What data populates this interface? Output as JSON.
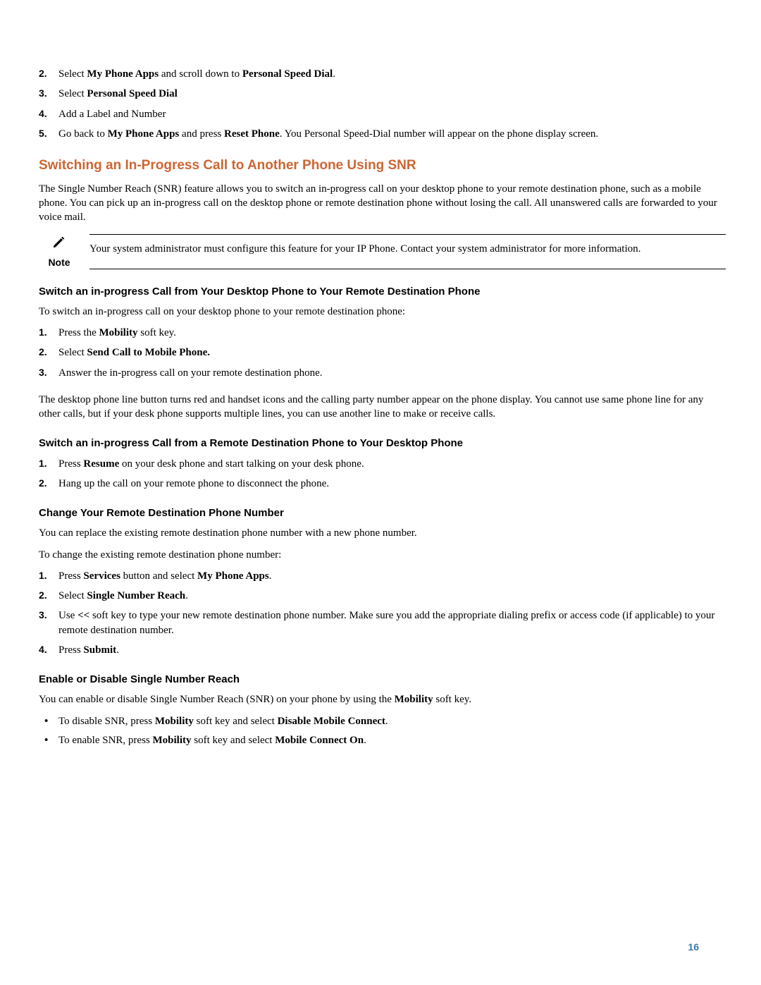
{
  "topList": [
    {
      "num": "2.",
      "html": "Select <b>My Phone Apps</b> and scroll down to <b>Personal Speed Dial</b>."
    },
    {
      "num": "3.",
      "html": "Select <b>Personal Speed Dial</b>"
    },
    {
      "num": "4.",
      "html": "Add a Label and Number"
    },
    {
      "num": "5.",
      "html": "Go back to <b>My Phone Apps</b> and press <b>Reset Phone</b>. You Personal Speed-Dial number will appear on the phone display screen."
    }
  ],
  "snr": {
    "heading": "Switching an In-Progress Call to Another Phone Using SNR",
    "intro": "The Single Number Reach (SNR) feature allows you to switch an in-progress call on your desktop phone to your remote destination phone, such as a mobile phone. You can pick up an in-progress call on the desktop phone or remote destination phone without losing the call. All unanswered calls are forwarded to your voice mail.",
    "noteLabel": "Note",
    "noteText": "Your system administrator must configure this feature for your IP Phone. Contact your system administrator for more information."
  },
  "switchToRemote": {
    "heading": "Switch an in-progress Call from Your Desktop Phone to Your Remote Destination Phone",
    "intro": "To switch an in-progress call on your desktop phone to your remote destination phone:",
    "steps": [
      {
        "num": "1.",
        "html": "Press the <b>Mobility</b> soft key."
      },
      {
        "num": "2.",
        "html": "Select <b>Send Call to Mobile Phone.</b>"
      },
      {
        "num": "3.",
        "html": "Answer the in-progress call on your remote destination phone."
      }
    ],
    "after": "The desktop phone line button turns red and handset icons and the calling party number appear on the phone display. You cannot use same phone line for any other calls, but if your desk phone supports multiple lines, you can use another line to make or receive calls."
  },
  "switchToDesktop": {
    "heading": "Switch an in-progress Call from a Remote Destination Phone to Your Desktop Phone",
    "steps": [
      {
        "num": "1.",
        "html": "Press <b>Resume</b> on your desk phone and start talking on your desk phone."
      },
      {
        "num": "2.",
        "html": "Hang up the call on your remote phone to disconnect the phone."
      }
    ]
  },
  "changeNumber": {
    "heading": "Change Your Remote Destination Phone Number",
    "p1": "You can replace the existing remote destination phone number with a new phone number.",
    "p2": "To change the existing remote destination phone number:",
    "steps": [
      {
        "num": "1.",
        "html": "Press <b>Services</b> button and select <b>My Phone Apps</b>."
      },
      {
        "num": "2.",
        "html": "Select <b>Single Number Reach</b>."
      },
      {
        "num": "3.",
        "html": "Use <b>&lt;&lt;</b> soft key to type your new remote destination phone number. Make sure you add the appropriate dialing prefix or access code (if applicable) to your remote destination number."
      },
      {
        "num": "4.",
        "html": "Press <b>Submit</b>."
      }
    ]
  },
  "enableDisable": {
    "heading": "Enable or Disable Single Number Reach",
    "intro": "You can enable or disable Single Number Reach (SNR) on your phone by using the <b>Mobility</b> soft key.",
    "bullets": [
      "To disable SNR, press <b>Mobility</b> soft key and select <b>Disable Mobile Connect</b>.",
      "To enable SNR, press <b>Mobility</b> soft key and select <b>Mobile Connect On</b>."
    ]
  },
  "pageNumber": "16"
}
